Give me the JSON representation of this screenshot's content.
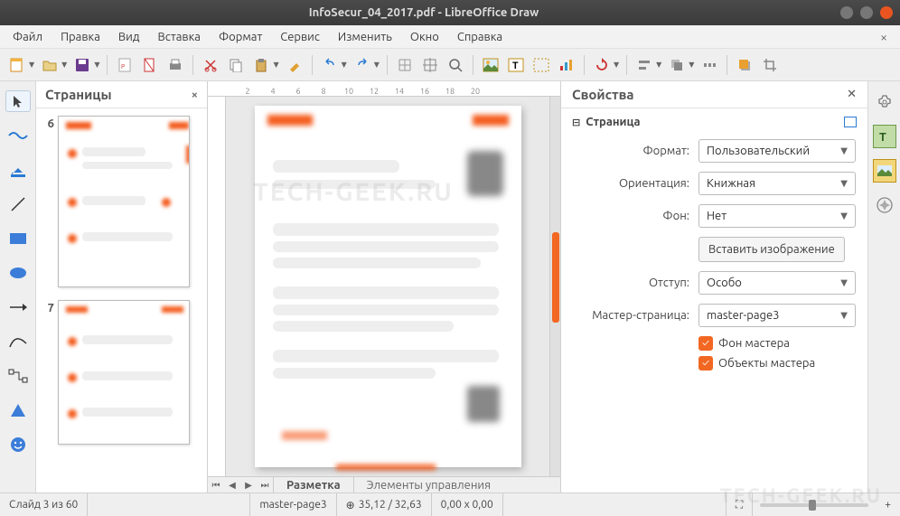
{
  "window": {
    "title": "InfoSecur_04_2017.pdf - LibreOffice Draw"
  },
  "menu": {
    "file": "Файл",
    "edit": "Правка",
    "view": "Вид",
    "insert": "Вставка",
    "format": "Формат",
    "tools": "Сервис",
    "modify": "Изменить",
    "window": "Окно",
    "help": "Справка"
  },
  "pages_panel": {
    "title": "Страницы",
    "thumbs": [
      "6",
      "7"
    ]
  },
  "ruler_ticks": [
    "2",
    "4",
    "6",
    "8",
    "10",
    "12",
    "14",
    "16",
    "18",
    "20"
  ],
  "tabs": {
    "layout": "Разметка",
    "controls": "Элементы управления"
  },
  "properties": {
    "title": "Свойства",
    "section": "Страница",
    "rows": {
      "format_label": "Формат:",
      "format_value": "Пользовательский",
      "orientation_label": "Ориентация:",
      "orientation_value": "Книжная",
      "background_label": "Фон:",
      "background_value": "Нет",
      "insert_image_btn": "Вставить изображение",
      "margin_label": "Отступ:",
      "margin_value": "Особо",
      "master_label": "Мастер-страница:",
      "master_value": "master-page3",
      "chk_master_bg": "Фон мастера",
      "chk_master_obj": "Объекты мастера"
    }
  },
  "status": {
    "slide": "Слайд 3 из 60",
    "master": "master-page3",
    "coords": "35,12 / 32,63",
    "size": "0,00 x 0,00"
  },
  "watermark": "TECH-GEEK.RU"
}
